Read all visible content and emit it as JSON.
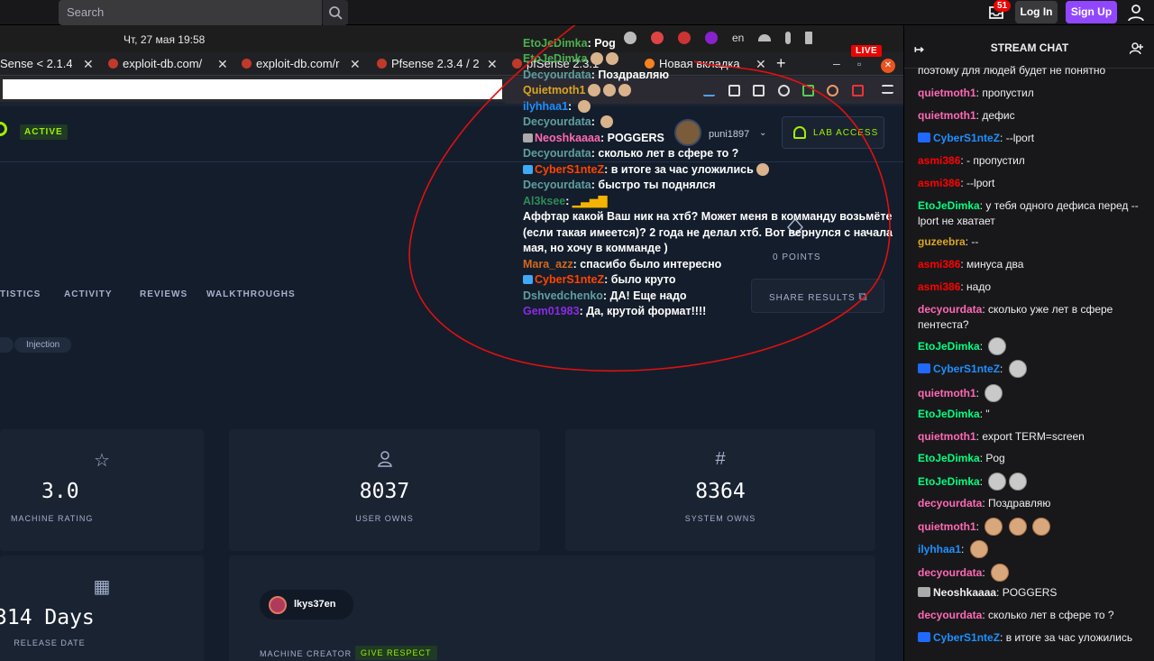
{
  "topbar": {
    "search_placeholder": "Search",
    "notif_count": "51",
    "login": "Log In",
    "signup": "Sign Up"
  },
  "desktop": {
    "clock": "Чт, 27 мая  19:58",
    "lang": "en"
  },
  "tabs": [
    {
      "label": "Sense < 2.1.4"
    },
    {
      "label": "exploit-db.com/"
    },
    {
      "label": "exploit-db.com/r"
    },
    {
      "label": "Pfsense 2.3.4 / 2"
    },
    {
      "label": "pfSense 2.3.1"
    },
    {
      "label": "Новая вкладка"
    }
  ],
  "stream": {
    "live": "LIVE"
  },
  "htb": {
    "status": "ACTIVE",
    "username": "puni1897",
    "lab_access": "LAB ACCESS",
    "points_label": "0 POINTS",
    "nav": [
      "TISTICS",
      "ACTIVITY",
      "REVIEWS",
      "WALKTHROUGHS"
    ],
    "share": "SHARE RESULTS",
    "tags": [
      "Injection"
    ],
    "stats": [
      {
        "icon": "star-icon",
        "value": "3.0",
        "label": "MACHINE RATING"
      },
      {
        "icon": "user-icon",
        "value": "8037",
        "label": "USER OWNS"
      },
      {
        "icon": "hash-icon",
        "value": "8364",
        "label": "SYSTEM OWNS"
      }
    ],
    "release": {
      "value": "314 Days",
      "label": "RELEASE DATE"
    },
    "creator": {
      "name": "lkys37en",
      "label": "MACHINE CREATOR",
      "give": "GIVE RESPECT"
    }
  },
  "overlay_chat": [
    {
      "user": "EtoJeDimka",
      "color": "#4caf50",
      "text": "Pog"
    },
    {
      "user": "EtoJeDimka",
      "color": "#4caf50",
      "text": ""
    },
    {
      "user": "Decyourdata",
      "color": "#5f9ea0",
      "text": "Поздравляю"
    },
    {
      "user": "Quietmoth1",
      "color": "#daa520",
      "text": ""
    },
    {
      "user": "ilyhhaa1",
      "color": "#1e90ff",
      "text": ""
    },
    {
      "user": "Decyourdata",
      "color": "#5f9ea0",
      "text": ""
    },
    {
      "user": "Neoshkaaaa",
      "color": "#ff69b4",
      "text": "POGGERS"
    },
    {
      "user": "Decyourdata",
      "color": "#5f9ea0",
      "text": "сколько лет в сфере то ?"
    },
    {
      "user": "CyberS1nteZ",
      "color": "#ff4500",
      "text": "в итоге за час уложились"
    },
    {
      "user": "Decyourdata",
      "color": "#5f9ea0",
      "text": "быстро ты поднялся"
    },
    {
      "user": "Al3ksee",
      "color": "#2e8b57",
      "text": ""
    },
    {
      "user": "",
      "color": "#ffffff",
      "text": "Аффтар какой Ваш ник на хтб? Может меня в комманду возьмёте (если такая имеется)? 2 года не делал хтб. Вот вернулся с начала мая, но хочу в комманде )"
    },
    {
      "user": "Mara_azz",
      "color": "#d2691e",
      "text": "спасибо было интересно"
    },
    {
      "user": "CyberS1nteZ",
      "color": "#ff4500",
      "text": "было круто"
    },
    {
      "user": "Dshvedchenko",
      "color": "#5f9ea0",
      "text": "ДА! Еще надо"
    },
    {
      "user": "Gem01983",
      "color": "#8a2be2",
      "text": "Да, крутой формат!!!!"
    }
  ],
  "chat": {
    "title": "STREAM CHAT",
    "messages": [
      {
        "user": "",
        "color": "#efeff1",
        "text": "поэтому для людей будет не понятно"
      },
      {
        "user": "quietmoth1",
        "color": "#ff69b4",
        "text": "пропустил"
      },
      {
        "user": "quietmoth1",
        "color": "#ff69b4",
        "text": "дефис"
      },
      {
        "user": "CyberS1nteZ",
        "color": "#1e90ff",
        "text": "--lport"
      },
      {
        "user": "asmi386",
        "color": "#ff0000",
        "text": "- пропустил"
      },
      {
        "user": "asmi386",
        "color": "#ff0000",
        "text": "--lport"
      },
      {
        "user": "EtoJeDimka",
        "color": "#00ff7f",
        "text": "у тебя одного дефиса перед --lport не хватает"
      },
      {
        "user": "guzeebra",
        "color": "#daa520",
        "text": "--"
      },
      {
        "user": "asmi386",
        "color": "#ff0000",
        "text": "минуса два"
      },
      {
        "user": "asmi386",
        "color": "#ff0000",
        "text": "надо"
      },
      {
        "user": "decyourdata",
        "color": "#ff69b4",
        "text": "сколько уже лет в сфере пентеста?"
      },
      {
        "user": "EtoJeDimka",
        "color": "#00ff7f",
        "text": ""
      },
      {
        "user": "CyberS1nteZ",
        "color": "#1e90ff",
        "text": ""
      },
      {
        "user": "quietmoth1",
        "color": "#ff69b4",
        "text": ""
      },
      {
        "user": "EtoJeDimka",
        "color": "#00ff7f",
        "text": "\""
      },
      {
        "user": "quietmoth1",
        "color": "#ff69b4",
        "text": "export TERM=screen"
      },
      {
        "user": "EtoJeDimka",
        "color": "#00ff7f",
        "text": "Pog"
      },
      {
        "user": "EtoJeDimka",
        "color": "#00ff7f",
        "text": ""
      },
      {
        "user": "decyourdata",
        "color": "#ff69b4",
        "text": "Поздравляю"
      },
      {
        "user": "quietmoth1",
        "color": "#ff69b4",
        "text": ""
      },
      {
        "user": "ilyhhaa1",
        "color": "#1e90ff",
        "text": ""
      },
      {
        "user": "decyourdata",
        "color": "#ff69b4",
        "text": ""
      },
      {
        "user": "Neoshkaaaa",
        "color": "#efeff1",
        "text": "POGGERS"
      },
      {
        "user": "decyourdata",
        "color": "#ff69b4",
        "text": "сколько лет в сфере то ?"
      },
      {
        "user": "CyberS1nteZ",
        "color": "#1e90ff",
        "text": "в итоге за час уложились"
      }
    ]
  }
}
